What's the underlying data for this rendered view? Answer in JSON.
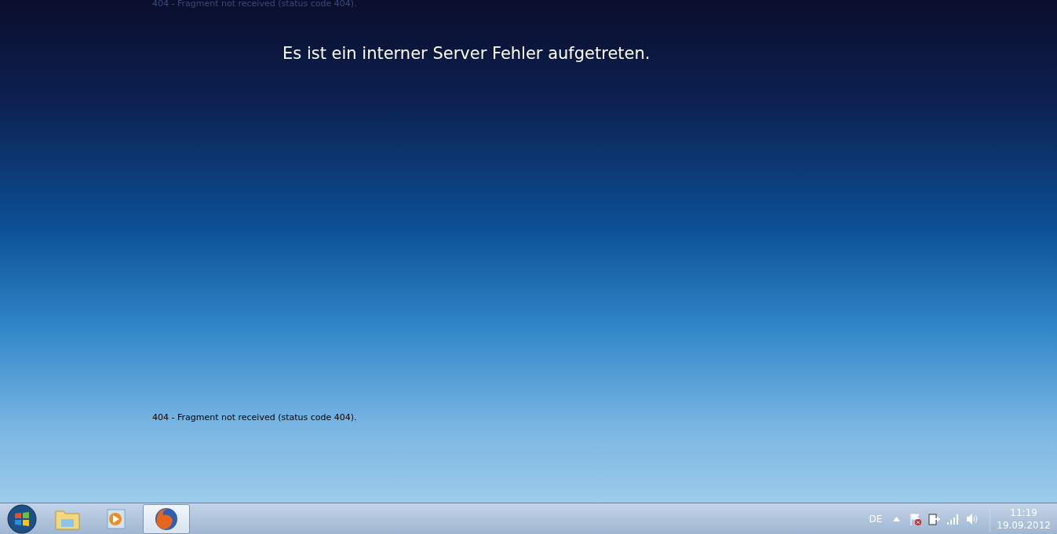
{
  "page": {
    "top_message": "404 - Fragment not received (status code 404).",
    "heading": "Es ist ein interner Server Fehler aufgetreten.",
    "bottom_message": "404 - Fragment not received (status code 404)."
  },
  "taskbar": {
    "apps": [
      {
        "kind": "explorer",
        "selected": false
      },
      {
        "kind": "media",
        "selected": false
      },
      {
        "kind": "browser",
        "selected": true
      }
    ],
    "language": "DE",
    "time": "11:19",
    "date": "19.09.2012"
  }
}
